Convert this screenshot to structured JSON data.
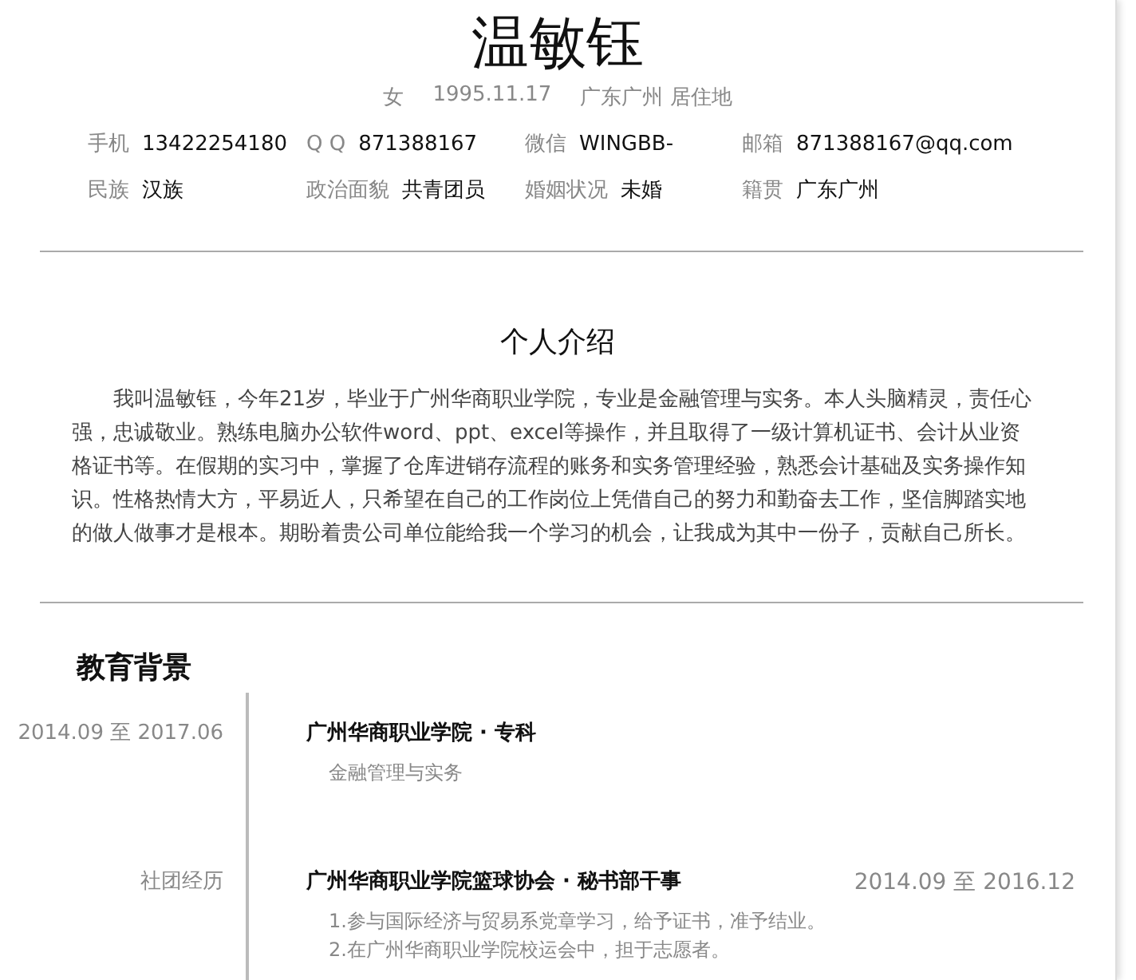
{
  "header": {
    "name": "温敏钰",
    "meta": [
      "女",
      "1995.11.17",
      "广东广州 居住地"
    ]
  },
  "info": [
    {
      "label": "手机",
      "value": "13422254180"
    },
    {
      "label": "Q Q",
      "value": "871388167"
    },
    {
      "label": "微信",
      "value": "WINGBB-"
    },
    {
      "label": "邮箱",
      "value": "871388167@qq.com"
    },
    {
      "label": "民族",
      "value": "汉族"
    },
    {
      "label": "政治面貌",
      "value": "共青团员"
    },
    {
      "label": "婚姻状况",
      "value": "未婚"
    },
    {
      "label": "籍贯",
      "value": "广东广州"
    }
  ],
  "intro": {
    "title": "个人介绍",
    "text": "我叫温敏钰，今年21岁，毕业于广州华商职业学院，专业是金融管理与实务。本人头脑精灵，责任心强，忠诚敬业。熟练电脑办公软件word、ppt、excel等操作，并且取得了一级计算机证书、会计从业资格证书等。在假期的实习中，掌握了仓库进销存流程的账务和实务管理经验，熟悉会计基础及实务操作知识。性格热情大方，平易近人，只希望在自己的工作岗位上凭借自己的努力和勤奋去工作，坚信脚踏实地的做人做事才是根本。期盼着贵公司单位能给我一个学习的机会，让我成为其中一份子，贡献自己所长。"
  },
  "education": {
    "title": "教育背景",
    "entries": [
      {
        "left": "2014.09 至 2017.06",
        "title": "广州华商职业学院 · 专科",
        "details": [
          "金融管理与实务"
        ]
      },
      {
        "left": "社团经历",
        "title": "广州华商职业学院篮球协会 · 秘书部干事",
        "date": "2014.09 至 2016.12",
        "details": [
          "1.参与国际经济与贸易系党章学习，给予证书，准予结业。",
          "2.在广州华商职业学院校运会中，担于志愿者。"
        ]
      }
    ]
  }
}
